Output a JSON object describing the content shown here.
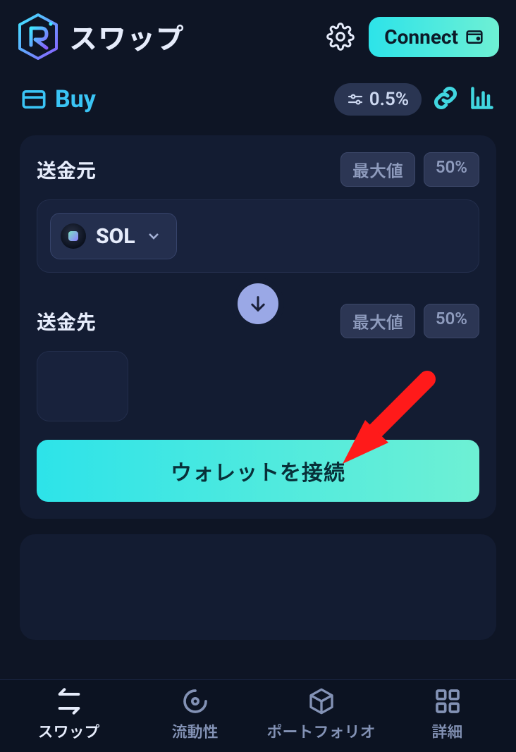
{
  "header": {
    "title": "スワップ",
    "connect_label": "Connect"
  },
  "subheader": {
    "buy_label": "Buy",
    "slippage": "0.5%"
  },
  "swap": {
    "from_label": "送金元",
    "to_label": "送金先",
    "max_label": "最大値",
    "half_label": "50%",
    "from_token": "SOL",
    "connect_wallet_label": "ウォレットを接続"
  },
  "nav": {
    "items": [
      {
        "label": "スワップ"
      },
      {
        "label": "流動性"
      },
      {
        "label": "ポートフォリオ"
      },
      {
        "label": "詳細"
      }
    ]
  }
}
